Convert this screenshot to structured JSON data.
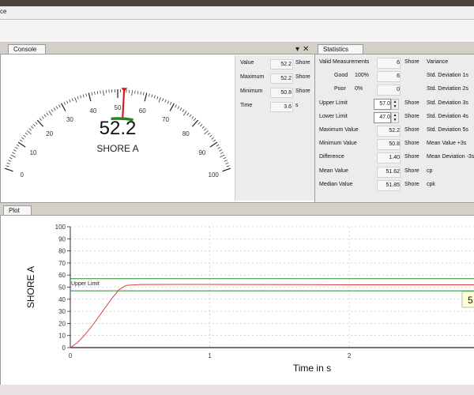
{
  "window": {
    "title_fragment": "ce"
  },
  "console": {
    "tab_label": "Console",
    "gauge": {
      "value": "52.2",
      "unit": "SHORE A",
      "needle_value": 52.2,
      "upper_limit": 57.0,
      "lower_limit": 47.0,
      "scale_labels": [
        "0",
        "10",
        "20",
        "30",
        "40",
        "50",
        "60",
        "70",
        "80",
        "90",
        "100"
      ]
    },
    "readouts": [
      {
        "label": "Value",
        "value": "52.2",
        "unit": "Shore"
      },
      {
        "label": "Maximum",
        "value": "52.2",
        "unit": "Shore"
      },
      {
        "label": "Minimum",
        "value": "50.8",
        "unit": "Shore"
      },
      {
        "label": "Time",
        "value": "3.6",
        "unit": "s"
      }
    ]
  },
  "statistics": {
    "tab_label": "Statistics",
    "rows": [
      {
        "label": "Valid Measurements",
        "value": "6",
        "unit": "Shore",
        "right": "Variance"
      },
      {
        "label": "Good",
        "pct": "100%",
        "value": "6",
        "unit": "",
        "right": "Std. Deviation 1s"
      },
      {
        "label": "Poor",
        "pct": "0%",
        "value": "0",
        "unit": "",
        "right": "Std. Deviation 2s"
      },
      {
        "label": "Upper Limit",
        "value": "57.0",
        "unit": "Shore",
        "right": "Std. Deviation 3s",
        "spin": true
      },
      {
        "label": "Lower Limit",
        "value": "47.0",
        "unit": "Shore",
        "right": "Std. Deviation 4s",
        "spin": true
      },
      {
        "label": "Maximum Value",
        "value": "52.2",
        "unit": "Shore",
        "right": "Std. Deviation 5s"
      },
      {
        "label": "Minimum Value",
        "value": "50.8",
        "unit": "Shore",
        "right": "Mean Value +3s"
      },
      {
        "label": "Difference",
        "value": "1.40",
        "unit": "Shore",
        "right": "Mean Deviation -3s"
      },
      {
        "label": "Mean Value",
        "value": "51.62",
        "unit": "Shore",
        "right": "cp"
      },
      {
        "label": "Median Value",
        "value": "51.85",
        "unit": "Shore",
        "right": "cpk"
      }
    ]
  },
  "plot": {
    "tab_label": "Plot",
    "chart_data": {
      "type": "line",
      "xlabel": "Time in s",
      "ylabel": "SHORE A",
      "xlim": [
        0,
        2.9
      ],
      "ylim": [
        0,
        100
      ],
      "y_ticks": [
        0,
        10,
        20,
        30,
        40,
        50,
        60,
        70,
        80,
        90,
        100
      ],
      "x_ticks": [
        0,
        1,
        2
      ],
      "grid": true,
      "series": [
        {
          "color": "#e23b3b",
          "x": [
            0,
            0.05,
            0.1,
            0.15,
            0.2,
            0.25,
            0.3,
            0.35,
            0.4,
            0.5,
            0.8,
            1.2,
            1.6,
            2.0,
            2.4,
            2.9
          ],
          "y": [
            0,
            4,
            10,
            17,
            25,
            33,
            41,
            48,
            51.5,
            52.2,
            52.3,
            52.2,
            52.1,
            52.0,
            52.0,
            52.0
          ]
        }
      ],
      "hlines": [
        {
          "y": 57,
          "label": "Upper Limit",
          "color": "#2e8b2e"
        },
        {
          "y": 47,
          "label": "",
          "color": "#2e8b2e"
        }
      ],
      "tooltip_text": "5"
    }
  }
}
